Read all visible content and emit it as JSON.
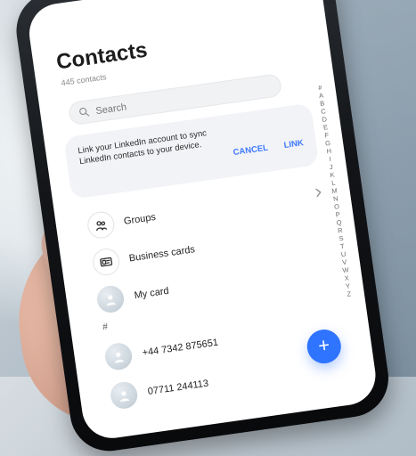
{
  "status": {
    "left": ""
  },
  "contacts": {
    "title": "Contacts",
    "count_label": "445 contacts",
    "search": {
      "placeholder": "Search"
    },
    "banner": {
      "text": "Link your LinkedIn account to sync LinkedIn contacts to your device.",
      "cancel_label": "CANCEL",
      "link_label": "LINK"
    },
    "menu": [
      {
        "label": "Groups",
        "icon": "groups-icon"
      },
      {
        "label": "Business cards",
        "icon": "business-card-icon"
      },
      {
        "label": "My card",
        "icon": "avatar-icon"
      }
    ],
    "section_label": "#",
    "numbers": [
      {
        "label": "+44 7342  875651"
      },
      {
        "label": "07711 244113"
      }
    ],
    "index": [
      "#",
      "A",
      "B",
      "C",
      "D",
      "E",
      "F",
      "G",
      "H",
      "I",
      "J",
      "K",
      "L",
      "M",
      "N",
      "O",
      "P",
      "Q",
      "R",
      "S",
      "T",
      "U",
      "V",
      "W",
      "X",
      "Y",
      "Z"
    ]
  },
  "colors": {
    "accent": "#2f74ff",
    "banner_bg": "#f2f3f6",
    "search_bg": "#f1f2f4"
  }
}
